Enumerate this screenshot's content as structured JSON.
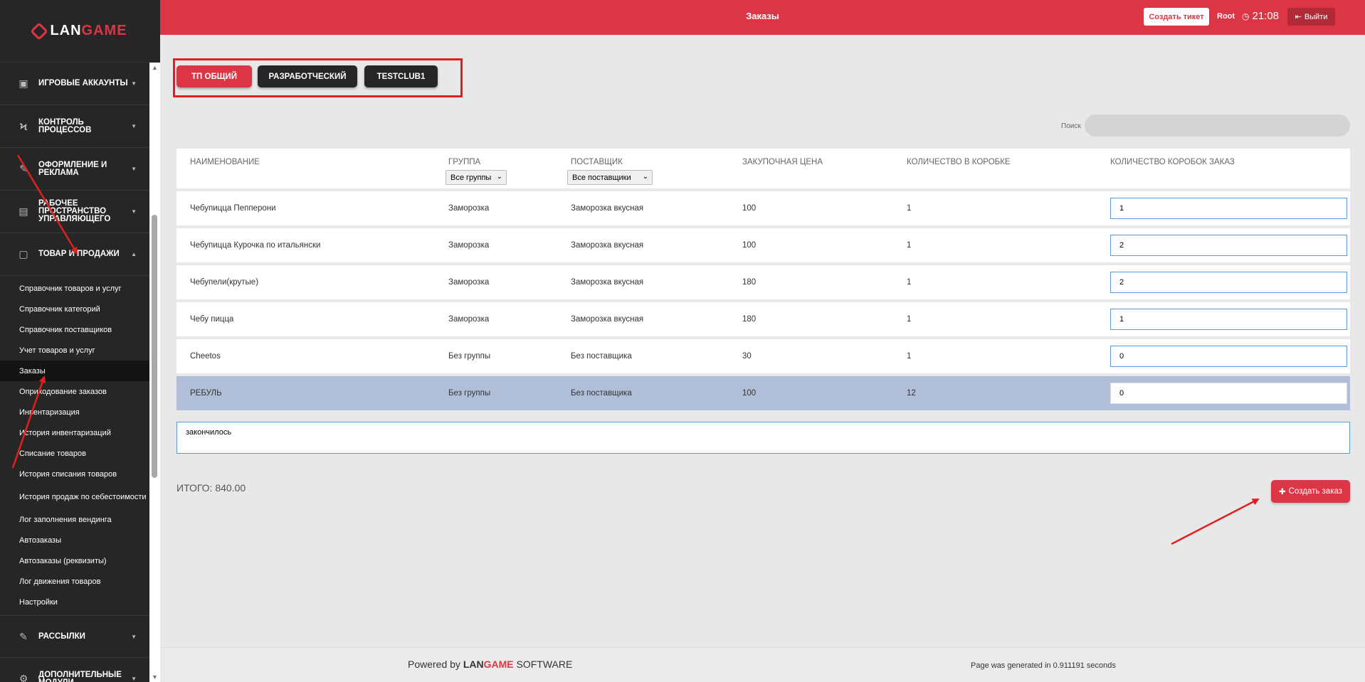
{
  "app": {
    "logo": {
      "part1": "LAN",
      "part2": "GAME"
    },
    "title": "Заказы",
    "create_ticket": "Создать тикет",
    "user": "Root",
    "time": "21:08",
    "logout": "Выйти"
  },
  "sidebar": {
    "sections": [
      {
        "label": "ИГРОВЫЕ АККАУНТЫ",
        "icon": "user-card-icon"
      },
      {
        "label": "КОНТРОЛЬ ПРОЦЕССОВ",
        "icon": "lightning-icon"
      },
      {
        "label": "ОФОРМЛЕНИЕ И РЕКЛАМА",
        "icon": "edit-icon"
      },
      {
        "label": "РАБОЧЕЕ ПРОСТРАНСТВО УПРАВЛЯЮЩЕГО",
        "icon": "briefcase-icon"
      },
      {
        "label": "ТОВАР И ПРОДАЖИ",
        "icon": "note-icon"
      },
      {
        "label": "РАССЫЛКИ",
        "icon": "edit-icon"
      },
      {
        "label": "ДОПОЛНИТЕЛЬНЫЕ МОДУЛИ",
        "icon": "gear-icon"
      }
    ],
    "sub_items": [
      "Справочник товаров и услуг",
      "Справочник категорий",
      "Справочник поставщиков",
      "Учет товаров и услуг",
      "Заказы",
      "Оприходование заказов",
      "Инвентаризация",
      "История инвентаризаций",
      "Списание товаров",
      "История списания товаров",
      "История продаж по себестоимости",
      "Лог заполнения вендинга",
      "Автозаказы",
      "Автозаказы (реквизиты)",
      "Лог движения товаров",
      "Настройки"
    ]
  },
  "tabs": [
    "ТП ОБЩИЙ",
    "РАЗРАБОТЧЕСКИЙ",
    "TESTCLUB1"
  ],
  "search": {
    "label": "Поиск",
    "value": ""
  },
  "table": {
    "headers": [
      "НАИМЕНОВАНИЕ",
      "ГРУППА",
      "ПОСТАВЩИК",
      "ЗАКУПОЧНАЯ ЦЕНА",
      "КОЛИЧЕСТВО В КОРОБКЕ",
      "КОЛИЧЕСТВО КОРОБОК ЗАКАЗ"
    ],
    "group_filter": "Все группы",
    "supplier_filter": "Все поставщики",
    "rows": [
      {
        "name": "Чебупицца Пепперони",
        "group": "Заморозка",
        "supplier": "Заморозка вкусная",
        "price": "100",
        "per_box": "1",
        "boxes": "1"
      },
      {
        "name": "Чебупицца Курочка по итальянски",
        "group": "Заморозка",
        "supplier": "Заморозка вкусная",
        "price": "100",
        "per_box": "1",
        "boxes": "2"
      },
      {
        "name": "Чебупели(крутые)",
        "group": "Заморозка",
        "supplier": "Заморозка вкусная",
        "price": "180",
        "per_box": "1",
        "boxes": "2"
      },
      {
        "name": "Чебу пицца",
        "group": "Заморозка",
        "supplier": "Заморозка вкусная",
        "price": "180",
        "per_box": "1",
        "boxes": "1"
      },
      {
        "name": "Cheetos",
        "group": "Без группы",
        "supplier": "Без поставщика",
        "price": "30",
        "per_box": "1",
        "boxes": "0"
      },
      {
        "name": "РЕБУЛЬ",
        "group": "Без группы",
        "supplier": "Без поставщика",
        "price": "100",
        "per_box": "12",
        "boxes": "0"
      }
    ]
  },
  "comment": "закончилось",
  "total": "ИТОГО: 840.00",
  "create_order": "Создать заказ",
  "footer": {
    "powered_prefix": "Powered by",
    "brand_part1": "LAN",
    "brand_part2": "GAME",
    "brand_suffix": "SOFTWARE",
    "generated": "Page was generated in 0.911191 seconds"
  },
  "colors": {
    "accent": "#dc3545",
    "sidebar": "#262626",
    "selected_row": "#b0bed8",
    "annotation_arrow": "#e02020"
  }
}
